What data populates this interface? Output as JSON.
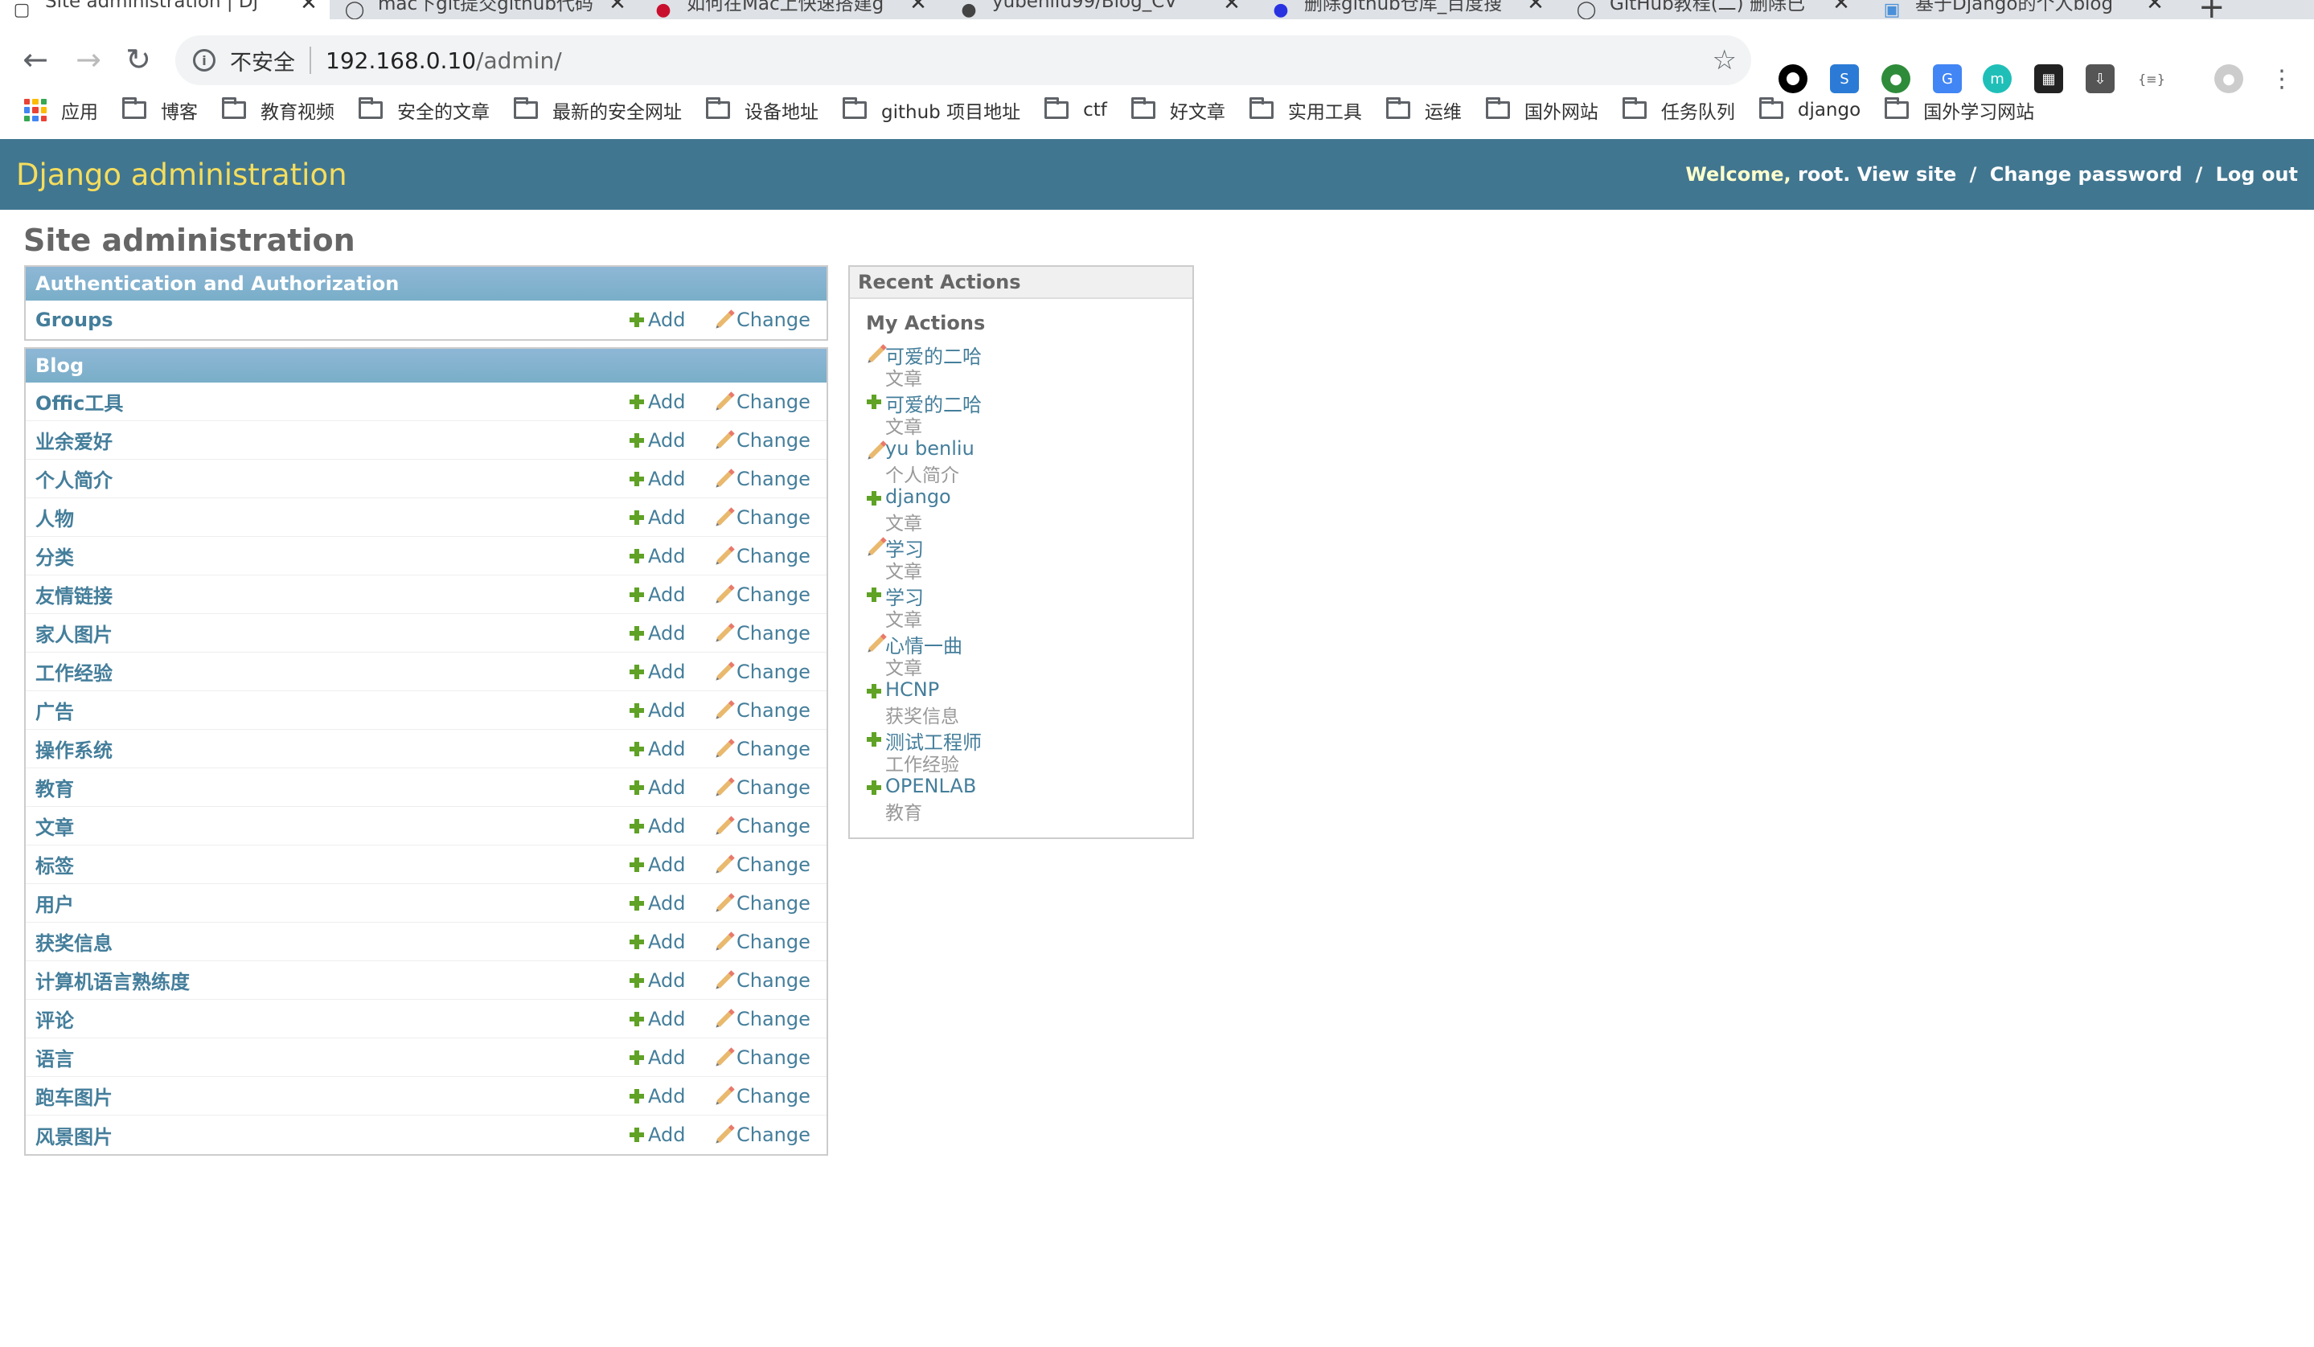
{
  "browser": {
    "tabs": [
      {
        "title": "Site administration | Dj",
        "icon": "page-icon",
        "active": true
      },
      {
        "title": "mac下git提交github代码",
        "icon": "github-icon",
        "active": false
      },
      {
        "title": "如何在Mac上快速搭建g",
        "icon": "csdn-icon",
        "active": false
      },
      {
        "title": "yubenliu99/Blog_CV",
        "icon": "github-octocat-icon",
        "active": false
      },
      {
        "title": "删除github仓库_百度搜",
        "icon": "baidu-icon",
        "active": false
      },
      {
        "title": "GitHub教程(二) 删除已",
        "icon": "github-icon",
        "active": false
      },
      {
        "title": "基于Django的个人blog",
        "icon": "blog-icon",
        "active": false
      }
    ],
    "new_tab": "+",
    "close_glyph": "✕",
    "omnibox": {
      "security_label": "不安全",
      "url_host": "192.168.0.10",
      "url_path": "/admin/"
    },
    "bookmarks": {
      "apps_label": "应用",
      "folders": [
        "博客",
        "教育视频",
        "安全的文章",
        "最新的安全网址",
        "设备地址",
        "github 项目地址",
        "ctf",
        "好文章",
        "实用工具",
        "运维",
        "国外网站",
        "任务队列",
        "django",
        "国外学习网站"
      ]
    }
  },
  "admin": {
    "branding": "Django administration",
    "user_tools": {
      "welcome": "Welcome, ",
      "username": "root",
      "period": ".",
      "view_site": "View site",
      "change_password": "Change password",
      "log_out": "Log out",
      "separator": "/"
    },
    "title": "Site administration",
    "add_label": "Add",
    "change_label": "Change",
    "apps": [
      {
        "name": "Authentication and Authorization",
        "models": [
          "Groups"
        ]
      },
      {
        "name": "Blog",
        "models": [
          "Offic工具",
          "业余爱好",
          "个人简介",
          "人物",
          "分类",
          "友情链接",
          "家人图片",
          "工作经验",
          "广告",
          "操作系统",
          "教育",
          "文章",
          "标签",
          "用户",
          "获奖信息",
          "计算机语言熟练度",
          "评论",
          "语言",
          "跑车图片",
          "风景图片"
        ]
      }
    ],
    "recent_actions": {
      "caption": "Recent Actions",
      "subtitle": "My Actions",
      "items": [
        {
          "title": "可爱的二哈",
          "type": "文章",
          "action": "change"
        },
        {
          "title": "可爱的二哈",
          "type": "文章",
          "action": "add"
        },
        {
          "title": "yu benliu",
          "type": "个人简介",
          "action": "change"
        },
        {
          "title": "django",
          "type": "文章",
          "action": "add"
        },
        {
          "title": "学习",
          "type": "文章",
          "action": "change"
        },
        {
          "title": "学习",
          "type": "文章",
          "action": "add"
        },
        {
          "title": "心情一曲",
          "type": "文章",
          "action": "change"
        },
        {
          "title": "HCNP",
          "type": "获奖信息",
          "action": "add"
        },
        {
          "title": "测试工程师",
          "type": "工作经验",
          "action": "add"
        },
        {
          "title": "OPENLAB",
          "type": "教育",
          "action": "add"
        }
      ]
    }
  }
}
